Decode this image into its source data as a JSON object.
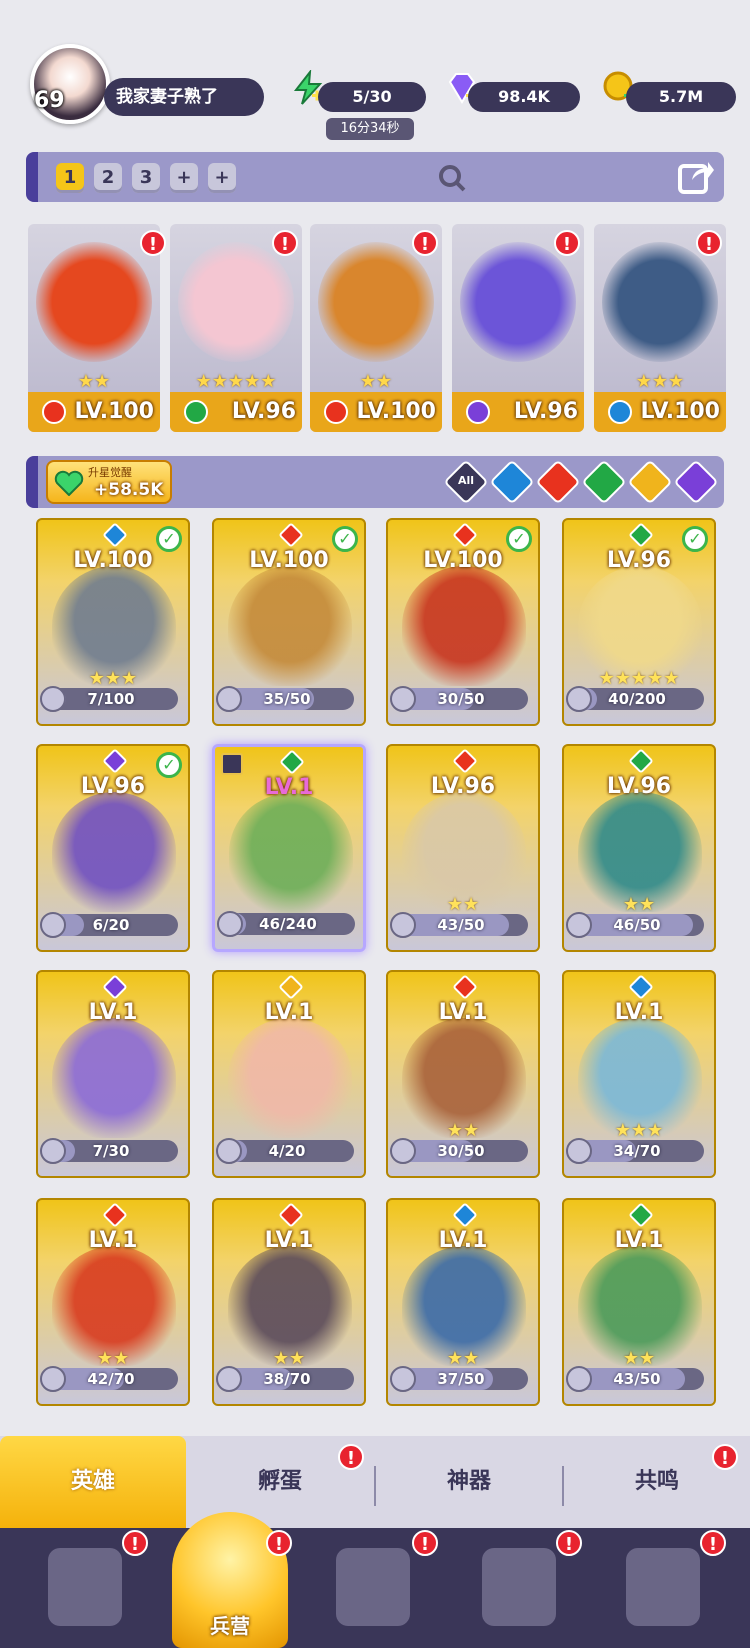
{
  "player": {
    "level": "69",
    "name": "我家妻子熟了"
  },
  "resources": {
    "energy": "5/30",
    "energy_timer": "16分34秒",
    "gems": "98.4K",
    "gold": "5.7M"
  },
  "team_tabs": [
    "1",
    "2",
    "3",
    "+",
    "+"
  ],
  "team": [
    {
      "level": "LV.100",
      "stars": "★★",
      "element_color": "#e8321e",
      "art_color": "#e5481f"
    },
    {
      "level": "LV.96",
      "stars": "★★★★★",
      "element_color": "#22a845",
      "art_color": "#f4c6d2"
    },
    {
      "level": "LV.100",
      "stars": "★★",
      "element_color": "#e8321e",
      "art_color": "#d9862d"
    },
    {
      "level": "LV.96",
      "stars": "",
      "element_color": "#7a3fd8",
      "art_color": "#6c55d8"
    },
    {
      "level": "LV.100",
      "stars": "★★★",
      "element_color": "#1e86d8",
      "art_color": "#3e5c86"
    }
  ],
  "awaken": {
    "label": "升星觉醒",
    "value": "+58.5K"
  },
  "filters": {
    "all": "All",
    "colors": [
      "#1e86d8",
      "#e8321e",
      "#22a845",
      "#f0b41c",
      "#7a3fd8"
    ]
  },
  "heroes": [
    {
      "level": "LV.100",
      "stars": "★★★",
      "progress": "7/100",
      "fill": 0.07,
      "element_color": "#1e86d8",
      "art_color": "#6f7c8f",
      "check": true
    },
    {
      "level": "LV.100",
      "stars": "",
      "progress": "35/50",
      "fill": 0.7,
      "element_color": "#e8321e",
      "art_color": "#c48a3a",
      "check": true
    },
    {
      "level": "LV.100",
      "stars": "",
      "progress": "30/50",
      "fill": 0.6,
      "element_color": "#e8321e",
      "art_color": "#c7341f",
      "check": true
    },
    {
      "level": "LV.96",
      "stars": "★★★★★",
      "progress": "40/200",
      "fill": 0.2,
      "element_color": "#22a845",
      "art_color": "#f0d98a",
      "check": true
    },
    {
      "level": "LV.96",
      "stars": "",
      "progress": "6/20",
      "fill": 0.3,
      "element_color": "#7a3fd8",
      "art_color": "#6f4fc2",
      "check": true
    },
    {
      "level": "LV.1",
      "stars": "",
      "progress": "46/240",
      "fill": 0.19,
      "element_color": "#22a845",
      "art_color": "#6cae58",
      "check": false,
      "selected": true
    },
    {
      "level": "LV.96",
      "stars": "★★",
      "progress": "43/50",
      "fill": 0.86,
      "element_color": "#e8321e",
      "art_color": "#d9c8a8",
      "check": false
    },
    {
      "level": "LV.96",
      "stars": "★★",
      "progress": "46/50",
      "fill": 0.92,
      "element_color": "#22a845",
      "art_color": "#2f8a8a",
      "check": false
    },
    {
      "level": "LV.1",
      "stars": "",
      "progress": "7/30",
      "fill": 0.23,
      "element_color": "#7a3fd8",
      "art_color": "#8a6ad8",
      "check": false
    },
    {
      "level": "LV.1",
      "stars": "",
      "progress": "4/20",
      "fill": 0.2,
      "element_color": "#f0b41c",
      "art_color": "#f0b8a8",
      "check": false
    },
    {
      "level": "LV.1",
      "stars": "★★",
      "progress": "30/50",
      "fill": 0.6,
      "element_color": "#e8321e",
      "art_color": "#a8613a",
      "check": false
    },
    {
      "level": "LV.1",
      "stars": "★★★",
      "progress": "34/70",
      "fill": 0.49,
      "element_color": "#1e86d8",
      "art_color": "#7ab8d8",
      "check": false
    },
    {
      "level": "LV.1",
      "stars": "★★",
      "progress": "42/70",
      "fill": 0.6,
      "element_color": "#e8321e",
      "art_color": "#d83a1f",
      "check": false
    },
    {
      "level": "LV.1",
      "stars": "★★",
      "progress": "38/70",
      "fill": 0.54,
      "element_color": "#e8321e",
      "art_color": "#5a4a5a",
      "check": false
    },
    {
      "level": "LV.1",
      "stars": "★★",
      "progress": "37/50",
      "fill": 0.74,
      "element_color": "#1e86d8",
      "art_color": "#3a6aa8",
      "check": false
    },
    {
      "level": "LV.1",
      "stars": "★★",
      "progress": "43/50",
      "fill": 0.86,
      "element_color": "#22a845",
      "art_color": "#4a9a5a",
      "check": false
    }
  ],
  "tabs": [
    "英雄",
    "孵蛋",
    "神器",
    "共鸣"
  ],
  "nav": {
    "active_label": "兵营"
  },
  "alert_mark": "!"
}
